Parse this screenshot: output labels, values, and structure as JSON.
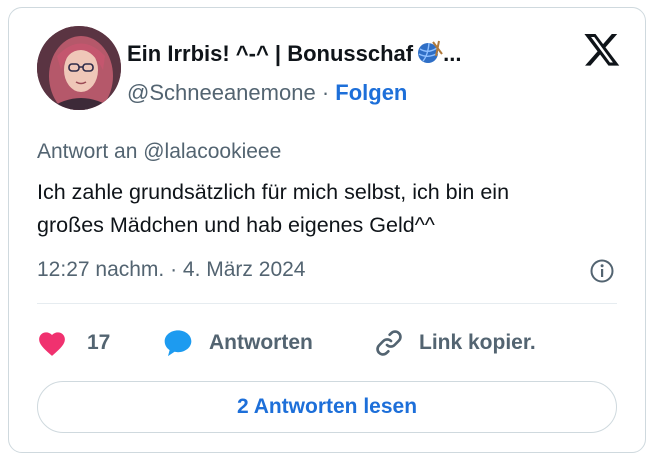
{
  "author": {
    "display_name": "Ein Irrbis! ^-^ | Bonusschaf",
    "name_icon": "yarn-ball-icon",
    "ellipsis": "...",
    "handle": "@Schneeanemone",
    "separator": "·",
    "follow_label": "Folgen"
  },
  "tweet": {
    "reply_to": "Antwort an @lalacookieee",
    "text_line1": "Ich zahle grundsätzlich für mich selbst, ich bin ein",
    "text_line2": "großes Mädchen und hab eigenes Geld^^",
    "timestamp": "12:27 nachm. · 4. März 2024"
  },
  "actions": {
    "like_count": "17",
    "reply_label": "Antworten",
    "copy_label": "Link kopier."
  },
  "read_replies_label": "2 Antworten lesen",
  "colors": {
    "accent": "#1d6fd9",
    "like": "#f0316f",
    "reply_icon": "#1d9bf0",
    "muted": "#536471",
    "border": "#cfd9de"
  },
  "icons": [
    "x-logo-icon",
    "info-icon",
    "heart-icon",
    "speech-bubble-icon",
    "link-icon",
    "yarn-ball-icon"
  ]
}
